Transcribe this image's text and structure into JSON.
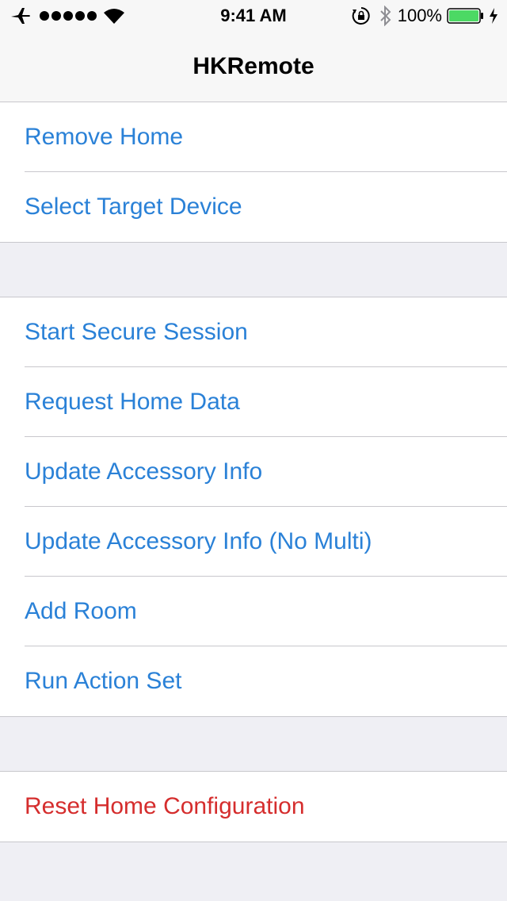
{
  "status_bar": {
    "time": "9:41 AM",
    "battery_percent": "100%",
    "battery_level": 1.0,
    "signal_dots": 5,
    "icons": [
      "airplane-icon",
      "signal-icon",
      "wifi-icon",
      "orientation-lock-icon",
      "bluetooth-icon",
      "battery-icon",
      "charging-icon"
    ]
  },
  "nav": {
    "title": "HKRemote"
  },
  "sections": [
    {
      "items": [
        {
          "label": "Remove Home"
        },
        {
          "label": "Select Target Device"
        }
      ]
    },
    {
      "items": [
        {
          "label": "Start Secure Session"
        },
        {
          "label": "Request Home Data"
        },
        {
          "label": "Update Accessory Info"
        },
        {
          "label": "Update Accessory Info (No Multi)"
        },
        {
          "label": "Add Room"
        },
        {
          "label": "Run Action Set"
        }
      ]
    },
    {
      "items": [
        {
          "label": "Reset Home Configuration",
          "style": "destructive"
        }
      ]
    }
  ],
  "colors": {
    "tint": "#2a81d7",
    "destructive": "#d52d2d",
    "background": "#efeff4",
    "battery_fill": "#4cd964"
  }
}
